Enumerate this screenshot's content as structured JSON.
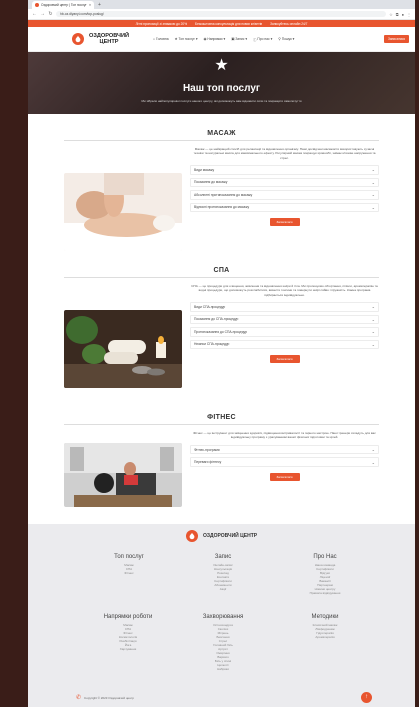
{
  "browser": {
    "tab_title": "Оздоровчий центр | Топ послуг",
    "tab_add": "+",
    "url": "hb-oz.dlyanyi.com/top-poslug/",
    "icons": [
      "back-icon",
      "forward-icon",
      "reload-icon",
      "star-icon",
      "extensions-icon",
      "profile-icon",
      "menu-icon"
    ]
  },
  "promo": {
    "items": [
      "Літні пропозиції зі знижкою до 20%",
      "Безкоштовна консультація для нових клієнтів",
      "Записуйтесь онлайн 24/7"
    ]
  },
  "header": {
    "logo_line1": "ОЗДОРОВЧИЙ",
    "logo_line2": "ЦЕНТР",
    "menu": [
      {
        "label": "Головна",
        "icon": "home-icon"
      },
      {
        "label": "Топ послуг",
        "icon": "star-icon"
      },
      {
        "label": "Напрямки",
        "icon": "compass-icon"
      },
      {
        "label": "Запис",
        "icon": "calendar-icon"
      },
      {
        "label": "Про нас",
        "icon": "info-icon"
      },
      {
        "label": "Пошук",
        "icon": "search-icon"
      }
    ],
    "cta_label": "Записатися"
  },
  "hero": {
    "title": "Наш топ послуг",
    "subtitle": "Ми зібрали найпопулярніші послуги нашого центру, які допоможуть вам відновити сили та покращити самопочуття"
  },
  "sections": [
    {
      "title": "МАСАЖ",
      "image": "massage-photo",
      "description": "Масаж — це найкращий спосіб для релаксації та відновлення організму. Наші досвідчені масажисти використовують сучасні техніки та натуральні масла для максимального ефекту. Регулярний масаж покращує кровообіг, знімає м'язове напруження та стрес.",
      "accordion": [
        "Види масажу",
        "Показання до масажу",
        "Абсолютні протипоказання до масажу",
        "Відносні протипоказання до масажу"
      ],
      "button": "Записатися"
    },
    {
      "title": "СПА",
      "image": "spa-photo",
      "description": "СПА — це процедури для очищення, живлення та відновлення шкіри й тіла. Ми пропонуємо обгортання, пілінги, ароматерапію та водні процедури, що допоможуть розслабитися, вивести токсини та повернути шкірі сяйво і пружність. Кожна програма підбирається індивідуально.",
      "accordion": [
        "Види СПА-процедур",
        "Показання до СПА-процедур",
        "Протипоказання до СПА-процедур",
        "Нюанси СПА-процедур"
      ],
      "button": "Записатися"
    },
    {
      "title": "ФІТНЕС",
      "image": "fitness-photo",
      "description": "Фітнес — це інструмент для зміцнення здоров'я, підвищення витривалості та гарного настрою. Наші тренери складуть для вас індивідуальну програму з урахуванням вашої фізичної підготовки та цілей.",
      "accordion": [
        "Фітнес-програми",
        "Переваги фітнесу"
      ],
      "button": "Записатися"
    }
  ],
  "footer": {
    "logo_text": "ОЗДОРОВЧИЙ ЦЕНТР",
    "columns": [
      {
        "title": "Топ послуг",
        "links": [
          "Масаж",
          "СПА",
          "Фітнес"
        ]
      },
      {
        "title": "Запис",
        "links": [
          "Онлайн-запис",
          "Консультація",
          "Розклад",
          "Контакти",
          "Сертифікати",
          "Абонементи",
          "Акції"
        ]
      },
      {
        "title": "Про Нас",
        "links": [
          "Наша команда",
          "Сертифікати",
          "Відгуки",
          "Ліцензії",
          "Вакансії",
          "Партнерам",
          "Новини центру",
          "Правила відвідування"
        ]
      },
      {
        "title": "Напрямки роботи",
        "links": [
          "Масаж",
          "СПА",
          "Фітнес",
          "Косметологія",
          "Реабілітація",
          "Йога",
          "Харчування"
        ]
      },
      {
        "title": "Захворювання",
        "links": [
          "Остеохондроз",
          "Сколіоз",
          "Мігрень",
          "Безсоння",
          "Стрес",
          "Головний біль",
          "Артрит",
          "Ожиріння",
          "Варикоз",
          "Біль у спині",
          "Целюліт",
          "Набряки"
        ]
      },
      {
        "title": "Методики",
        "links": [
          "Класичний масаж",
          "Лімфодренаж",
          "Гідротерапія",
          "Ароматерапія"
        ]
      }
    ],
    "copyright": "Copyright © 2023 Оздоровчий центр",
    "to_top": "↑"
  },
  "colors": {
    "accent": "#e8552f",
    "hero_bg": "#3a2b2b",
    "footer_bg": "#ebebee",
    "frame": "#3a1d18"
  }
}
